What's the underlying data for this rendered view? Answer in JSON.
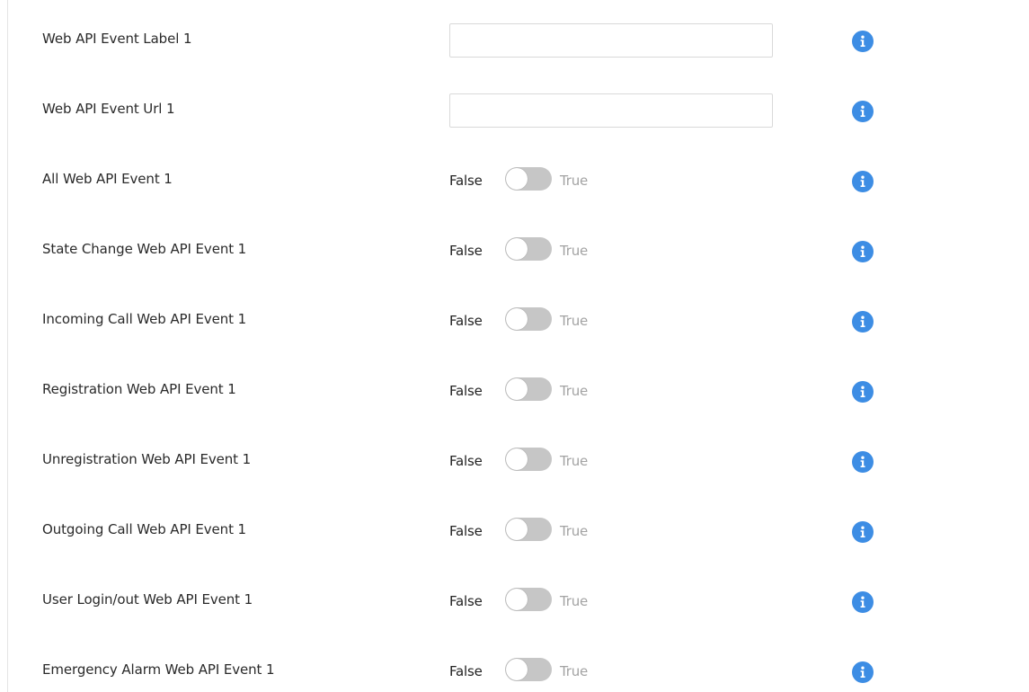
{
  "settings": {
    "text_fields": [
      {
        "label": "Web API Event Label 1",
        "value": "",
        "placeholder": ""
      },
      {
        "label": "Web API Event Url 1",
        "value": "",
        "placeholder": ""
      }
    ],
    "toggles": [
      {
        "label": "All Web API Event 1",
        "false_text": "False",
        "true_text": "True",
        "value": false
      },
      {
        "label": "State Change Web API Event 1",
        "false_text": "False",
        "true_text": "True",
        "value": false
      },
      {
        "label": "Incoming Call Web API Event 1",
        "false_text": "False",
        "true_text": "True",
        "value": false
      },
      {
        "label": "Registration Web API Event 1",
        "false_text": "False",
        "true_text": "True",
        "value": false
      },
      {
        "label": "Unregistration Web API Event 1",
        "false_text": "False",
        "true_text": "True",
        "value": false
      },
      {
        "label": "Outgoing Call Web API Event 1",
        "false_text": "False",
        "true_text": "True",
        "value": false
      },
      {
        "label": "User Login/out Web API Event 1",
        "false_text": "False",
        "true_text": "True",
        "value": false
      },
      {
        "label": "Emergency Alarm Web API Event 1",
        "false_text": "False",
        "true_text": "True",
        "value": false
      }
    ]
  },
  "icons": {
    "info": "info-icon"
  },
  "colors": {
    "info_icon": "#3d8de4",
    "toggle_off": "#c6c6c6",
    "true_text": "#a3a3a3",
    "input_border": "#d9d9d9"
  }
}
